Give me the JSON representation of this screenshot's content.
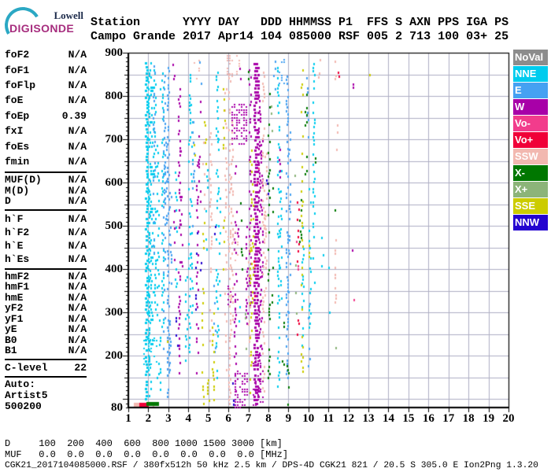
{
  "logo": {
    "top": "Lowell",
    "bottom": "DIGISONDE"
  },
  "header": {
    "line1": "Station      YYYY DAY   DDD HHMMSS P1  FFS S AXN PPS IGA PS",
    "line2": "Campo Grande 2017 Apr14 104 085000 RSF 005 2 713 100 03+ 25"
  },
  "params": {
    "sections": [
      [
        {
          "label": "foF2",
          "value": "N/A"
        },
        {
          "label": "foF1",
          "value": "N/A"
        },
        {
          "label": "foFlp",
          "value": "N/A"
        },
        {
          "label": "foE",
          "value": "N/A"
        },
        {
          "label": "foEp",
          "value": "0.39"
        },
        {
          "label": "fxI",
          "value": "N/A"
        },
        {
          "label": "foEs",
          "value": "N/A"
        },
        {
          "label": "fmin",
          "value": "N/A"
        }
      ],
      [
        {
          "label": "MUF(D)",
          "value": "N/A"
        },
        {
          "label": "M(D)",
          "value": "N/A"
        },
        {
          "label": "D",
          "value": "N/A"
        }
      ],
      [
        {
          "label": "h`F",
          "value": "N/A"
        },
        {
          "label": "h`F2",
          "value": "N/A"
        },
        {
          "label": "h`E",
          "value": "N/A"
        },
        {
          "label": "h`Es",
          "value": "N/A"
        }
      ],
      [
        {
          "label": "hmF2",
          "value": "N/A"
        },
        {
          "label": "hmF1",
          "value": "N/A"
        },
        {
          "label": "hmE",
          "value": "N/A"
        },
        {
          "label": "yF2",
          "value": "N/A"
        },
        {
          "label": "yF1",
          "value": "N/A"
        },
        {
          "label": "yE",
          "value": "N/A"
        },
        {
          "label": "B0",
          "value": "N/A"
        },
        {
          "label": "B1",
          "value": "N/A"
        }
      ],
      [
        {
          "label": "C-level",
          "value": "22"
        }
      ],
      [
        {
          "label": "Auto:",
          "value": ""
        },
        {
          "label": "Artist5",
          "value": ""
        },
        {
          "label": "500200",
          "value": ""
        }
      ]
    ]
  },
  "chart_data": {
    "type": "scatter",
    "title": "Digisonde ionogram, Campo Grande, 2017 Apr14 day 104, 08:50:00",
    "xlabel": "[MHz]",
    "ylabel": "[km]",
    "x_range": [
      1,
      20
    ],
    "y_range": [
      80,
      900
    ],
    "x_ticks": [
      1,
      2,
      3,
      4,
      5,
      6,
      7,
      8,
      9,
      10,
      11,
      12,
      13,
      14,
      15,
      16,
      17,
      18,
      19,
      20
    ],
    "y_ticks": [
      900,
      800,
      700,
      600,
      500,
      400,
      300,
      200,
      80
    ],
    "grid": {
      "x_step_mhz": 1,
      "y_step_km": 50,
      "color": "#AEAEC4"
    },
    "legend": [
      {
        "label": "NoVal",
        "color": "#8C8C8C"
      },
      {
        "label": "NNE",
        "color": "#00CCEE"
      },
      {
        "label": "E",
        "color": "#45A1F2"
      },
      {
        "label": "W",
        "color": "#A800A8"
      },
      {
        "label": "Vo-",
        "color": "#F23C8C"
      },
      {
        "label": "Vo+",
        "color": "#F00038"
      },
      {
        "label": "SSW",
        "color": "#F2B8B0"
      },
      {
        "label": "X-",
        "color": "#007700"
      },
      {
        "label": "X+",
        "color": "#8CB479"
      },
      {
        "label": "SSE",
        "color": "#CCCC00"
      },
      {
        "label": "NNW",
        "color": "#2404D0"
      }
    ],
    "streaks": [
      [
        1.92,
        100,
        880,
        "NNE",
        0.8
      ],
      [
        2.02,
        160,
        860,
        "NNE",
        0.55
      ],
      [
        2.12,
        100,
        880,
        "NNE",
        0.7
      ],
      [
        2.22,
        220,
        840,
        "NNE",
        0.5
      ],
      [
        2.35,
        300,
        860,
        "NNE",
        0.4
      ],
      [
        2.48,
        150,
        690,
        "NNE",
        0.35
      ],
      [
        2.58,
        90,
        380,
        "NNE",
        0.3
      ],
      [
        2.72,
        260,
        870,
        "NNE",
        0.5
      ],
      [
        3.38,
        360,
        630,
        "NNE",
        0.3
      ],
      [
        3.92,
        150,
        540,
        "NNE",
        0.3
      ],
      [
        4.05,
        210,
        870,
        "NNE",
        0.5
      ],
      [
        4.18,
        300,
        780,
        "NNE",
        0.35
      ],
      [
        4.95,
        430,
        660,
        "NNE",
        0.25
      ],
      [
        5.45,
        150,
        860,
        "NNE",
        0.45
      ],
      [
        5.58,
        260,
        700,
        "NNE",
        0.3
      ],
      [
        6.55,
        200,
        390,
        "NNE",
        0.25
      ],
      [
        8.5,
        130,
        870,
        "NNE",
        0.5
      ],
      [
        8.62,
        300,
        690,
        "NNE",
        0.3
      ],
      [
        9.75,
        200,
        500,
        "NNE",
        0.3
      ],
      [
        10.1,
        250,
        600,
        "NNE",
        0.35
      ],
      [
        10.3,
        330,
        880,
        "NNE",
        0.4
      ],
      [
        10.7,
        400,
        500,
        "NNE",
        0.25
      ],
      [
        11.05,
        300,
        420,
        "NNE",
        0.2
      ],
      [
        2.6,
        800,
        880,
        "NNE",
        0.5
      ],
      [
        2.28,
        430,
        870,
        "E",
        0.35
      ],
      [
        2.8,
        200,
        850,
        "E",
        0.45
      ],
      [
        3.02,
        90,
        880,
        "E",
        0.65
      ],
      [
        3.14,
        160,
        600,
        "E",
        0.35
      ],
      [
        4.28,
        500,
        800,
        "E",
        0.3
      ],
      [
        4.62,
        830,
        885,
        "E",
        0.5
      ],
      [
        5.32,
        210,
        400,
        "E",
        0.3
      ],
      [
        8.95,
        150,
        870,
        "E",
        0.6
      ],
      [
        9.05,
        300,
        720,
        "E",
        0.4
      ],
      [
        8.3,
        800,
        880,
        "E",
        0.4
      ],
      [
        9.95,
        690,
        860,
        "E",
        0.3
      ],
      [
        10.05,
        160,
        350,
        "E",
        0.25
      ],
      [
        2.9,
        500,
        700,
        "E",
        0.3
      ],
      [
        3.32,
        390,
        600,
        "W",
        0.3
      ],
      [
        3.55,
        160,
        820,
        "W",
        0.5
      ],
      [
        3.67,
        400,
        700,
        "W",
        0.3
      ],
      [
        4.45,
        160,
        650,
        "W",
        0.4
      ],
      [
        4.57,
        500,
        830,
        "W",
        0.3
      ],
      [
        6.35,
        110,
        660,
        "W",
        0.4
      ],
      [
        6.47,
        300,
        620,
        "W",
        0.3
      ],
      [
        6.95,
        250,
        520,
        "W",
        0.5
      ],
      [
        7.1,
        300,
        870,
        "W",
        0.5
      ],
      [
        7.32,
        90,
        880,
        "W",
        0.9
      ],
      [
        7.44,
        90,
        880,
        "W",
        0.8
      ],
      [
        7.56,
        110,
        860,
        "W",
        0.65
      ],
      [
        7.68,
        200,
        700,
        "W",
        0.45
      ],
      [
        8.6,
        580,
        700,
        "W",
        0.2
      ],
      [
        12.2,
        340,
        470,
        "W",
        0.2
      ],
      [
        12.3,
        820,
        860,
        "W",
        0.25
      ],
      [
        3.3,
        840,
        880,
        "W",
        0.5
      ],
      [
        6.6,
        840,
        885,
        "W",
        0.6
      ],
      [
        4.78,
        500,
        700,
        "SSW",
        0.25
      ],
      [
        5.15,
        210,
        720,
        "SSW",
        0.4
      ],
      [
        5.88,
        160,
        830,
        "SSW",
        0.35
      ],
      [
        6.08,
        90,
        850,
        "SSW",
        0.55
      ],
      [
        6.18,
        260,
        750,
        "SSW",
        0.45
      ],
      [
        7.05,
        200,
        500,
        "SSW",
        0.4
      ],
      [
        7.78,
        110,
        860,
        "SSW",
        0.5
      ],
      [
        7.9,
        300,
        690,
        "SSW",
        0.35
      ],
      [
        10.55,
        820,
        885,
        "SSW",
        0.4
      ],
      [
        11.38,
        300,
        470,
        "SSW",
        0.45
      ],
      [
        11.48,
        660,
        750,
        "SSW",
        0.35
      ],
      [
        11.35,
        840,
        888,
        "SSW",
        0.3
      ],
      [
        13.95,
        865,
        880,
        "SSW",
        0.25
      ],
      [
        2.3,
        85,
        120,
        "SSW",
        0.3
      ],
      [
        9.5,
        250,
        560,
        "Vo+",
        0.35
      ],
      [
        7.28,
        330,
        430,
        "Vo+",
        0.3
      ],
      [
        11.55,
        830,
        860,
        "Vo+",
        0.2
      ],
      [
        7.5,
        600,
        690,
        "Vo-",
        0.25
      ],
      [
        12.25,
        330,
        360,
        "Vo-",
        0.3
      ],
      [
        9.45,
        400,
        480,
        "Vo-",
        0.25
      ],
      [
        8.05,
        150,
        820,
        "X-",
        0.35
      ],
      [
        8.18,
        300,
        650,
        "X-",
        0.2
      ],
      [
        6.68,
        400,
        560,
        "X-",
        0.22
      ],
      [
        9.6,
        440,
        560,
        "X-",
        0.25
      ],
      [
        9.88,
        500,
        870,
        "X-",
        0.2
      ],
      [
        11.38,
        480,
        545,
        "X-",
        0.3
      ],
      [
        6.98,
        840,
        882,
        "X-",
        0.3
      ],
      [
        8.98,
        80,
        200,
        "X-",
        0.3
      ],
      [
        10.4,
        640,
        680,
        "X-",
        0.25
      ],
      [
        8.75,
        180,
        280,
        "X-",
        0.25
      ],
      [
        8.15,
        680,
        780,
        "X+",
        0.2
      ],
      [
        9.4,
        250,
        420,
        "X+",
        0.2
      ],
      [
        6.88,
        200,
        330,
        "X+",
        0.22
      ],
      [
        11.42,
        195,
        235,
        "X+",
        0.3
      ],
      [
        10.0,
        560,
        600,
        "X+",
        0.25
      ],
      [
        9.3,
        600,
        650,
        "X+",
        0.2
      ],
      [
        4.72,
        90,
        500,
        "SSE",
        0.3
      ],
      [
        4.84,
        500,
        800,
        "SSE",
        0.25
      ],
      [
        5.25,
        90,
        300,
        "SSE",
        0.35
      ],
      [
        5.78,
        400,
        830,
        "SSE",
        0.25
      ],
      [
        7.15,
        90,
        690,
        "SSE",
        0.4
      ],
      [
        7.22,
        300,
        600,
        "SSE",
        0.25
      ],
      [
        9.68,
        140,
        860,
        "SSE",
        0.35
      ],
      [
        5.02,
        80,
        160,
        "SSE",
        0.45
      ],
      [
        13.05,
        850,
        880,
        "SSE",
        0.25
      ],
      [
        4.35,
        600,
        700,
        "SSE",
        0.3
      ],
      [
        10.05,
        430,
        460,
        "SSE",
        0.3
      ],
      [
        2.95,
        200,
        260,
        "SSE",
        0.3
      ],
      [
        4.42,
        300,
        520,
        "NNW",
        0.22
      ],
      [
        5.35,
        450,
        550,
        "NNW",
        0.28
      ],
      [
        7.95,
        550,
        650,
        "NNW",
        0.22
      ],
      [
        3.45,
        200,
        290,
        "NNW",
        0.25
      ],
      [
        6.22,
        80,
        140,
        "NNW",
        0.35
      ],
      [
        9.32,
        330,
        360,
        "NNW",
        0.3
      ],
      [
        4.65,
        390,
        420,
        "NNW",
        0.3
      ]
    ],
    "blobs": [
      [
        6.2,
        6.95,
        690,
        780,
        "W",
        0.5
      ],
      [
        5.95,
        6.6,
        845,
        893,
        "SSW",
        0.4
      ],
      [
        6.0,
        6.6,
        420,
        490,
        "SSW",
        0.3
      ],
      [
        6.35,
        7.0,
        80,
        170,
        "W",
        0.45
      ],
      [
        7.25,
        7.75,
        80,
        200,
        "W",
        0.4
      ],
      [
        6.0,
        6.5,
        300,
        360,
        "W",
        0.28
      ],
      [
        1.8,
        2.45,
        180,
        240,
        "NNE",
        0.35
      ],
      [
        8.55,
        8.9,
        830,
        885,
        "E",
        0.35
      ],
      [
        4.3,
        4.75,
        840,
        885,
        "SSW",
        0.3
      ]
    ],
    "e_trace": [
      [
        1.32,
        1.64,
        87,
        "SSW"
      ],
      [
        1.6,
        1.98,
        88,
        "Vo+"
      ],
      [
        1.96,
        2.46,
        90,
        "X-"
      ]
    ]
  },
  "bottom": {
    "d_line": "D     100  200  400  600  800 1000 1500 3000 [km]",
    "muf_line": "MUF   0.0  0.0  0.0  0.0  0.0  0.0  0.0  0.0 [MHz]",
    "file_line": "CGK21_2017104085000.RSF / 380fx512h 50 kHz 2.5 km / DPS-4D CGK21 821 / 20.5 S 305.0 E Ion2Png 1.3.20"
  }
}
